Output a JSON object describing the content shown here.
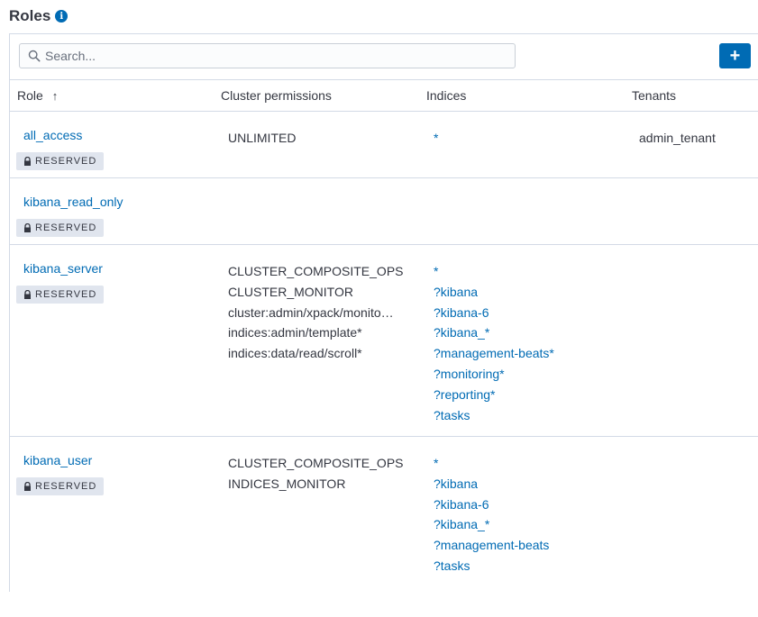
{
  "page": {
    "title": "Roles"
  },
  "toolbar": {
    "search_placeholder": "Search...",
    "add_button_icon": "plus-icon"
  },
  "table": {
    "columns": {
      "role": "Role",
      "cluster_permissions": "Cluster permissions",
      "indices": "Indices",
      "tenants": "Tenants"
    },
    "sort_indicator": "↑",
    "rows": [
      {
        "role": "all_access",
        "badge": "RESERVED",
        "cluster_permissions": [
          "UNLIMITED"
        ],
        "indices": [
          "*"
        ],
        "tenants": [
          "admin_tenant"
        ]
      },
      {
        "role": "kibana_read_only",
        "badge": "RESERVED",
        "cluster_permissions": [],
        "indices": [],
        "tenants": []
      },
      {
        "role": "kibana_server",
        "badge": "RESERVED",
        "cluster_permissions": [
          "CLUSTER_COMPOSITE_OPS",
          "CLUSTER_MONITOR",
          "cluster:admin/xpack/monito…",
          "indices:admin/template*",
          "indices:data/read/scroll*"
        ],
        "indices": [
          "*",
          "?kibana",
          "?kibana-6",
          "?kibana_*",
          "?management-beats*",
          "?monitoring*",
          "?reporting*",
          "?tasks"
        ],
        "tenants": []
      },
      {
        "role": "kibana_user",
        "badge": "RESERVED",
        "cluster_permissions": [
          "CLUSTER_COMPOSITE_OPS",
          "INDICES_MONITOR"
        ],
        "indices": [
          "*",
          "?kibana",
          "?kibana-6",
          "?kibana_*",
          "?management-beats",
          "?tasks"
        ],
        "tenants": []
      }
    ]
  },
  "colors": {
    "accent": "#006bb4",
    "badge_bg": "#e0e5ee",
    "border": "#d3dae6"
  }
}
